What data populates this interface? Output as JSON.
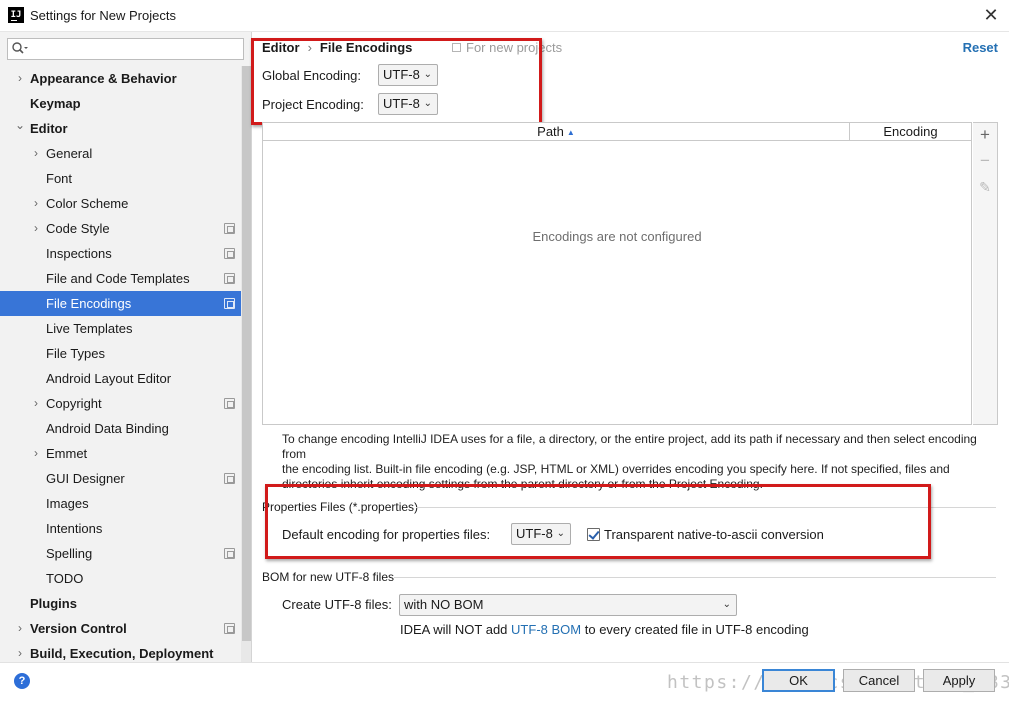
{
  "window": {
    "title": "Settings for New Projects",
    "logo_text": "IJ",
    "close_glyph": "✕"
  },
  "search": {
    "placeholder": "",
    "icon": "search-icon"
  },
  "sidebar": {
    "items": [
      {
        "label": "Appearance & Behavior",
        "level": 0,
        "arrow": "›",
        "bold": true,
        "proj": false,
        "selected": false
      },
      {
        "label": "Keymap",
        "level": 0,
        "arrow": "",
        "bold": true,
        "proj": false,
        "selected": false
      },
      {
        "label": "Editor",
        "level": 0,
        "arrow": "⌄",
        "bold": true,
        "proj": false,
        "selected": false
      },
      {
        "label": "General",
        "level": 1,
        "arrow": "›",
        "bold": false,
        "proj": false,
        "selected": false
      },
      {
        "label": "Font",
        "level": 1,
        "arrow": "",
        "bold": false,
        "proj": false,
        "selected": false
      },
      {
        "label": "Color Scheme",
        "level": 1,
        "arrow": "›",
        "bold": false,
        "proj": false,
        "selected": false
      },
      {
        "label": "Code Style",
        "level": 1,
        "arrow": "›",
        "bold": false,
        "proj": true,
        "selected": false
      },
      {
        "label": "Inspections",
        "level": 1,
        "arrow": "",
        "bold": false,
        "proj": true,
        "selected": false
      },
      {
        "label": "File and Code Templates",
        "level": 1,
        "arrow": "",
        "bold": false,
        "proj": true,
        "selected": false
      },
      {
        "label": "File Encodings",
        "level": 1,
        "arrow": "",
        "bold": false,
        "proj": true,
        "selected": true
      },
      {
        "label": "Live Templates",
        "level": 1,
        "arrow": "",
        "bold": false,
        "proj": false,
        "selected": false
      },
      {
        "label": "File Types",
        "level": 1,
        "arrow": "",
        "bold": false,
        "proj": false,
        "selected": false
      },
      {
        "label": "Android Layout Editor",
        "level": 1,
        "arrow": "",
        "bold": false,
        "proj": false,
        "selected": false
      },
      {
        "label": "Copyright",
        "level": 1,
        "arrow": "›",
        "bold": false,
        "proj": true,
        "selected": false
      },
      {
        "label": "Android Data Binding",
        "level": 1,
        "arrow": "",
        "bold": false,
        "proj": false,
        "selected": false
      },
      {
        "label": "Emmet",
        "level": 1,
        "arrow": "›",
        "bold": false,
        "proj": false,
        "selected": false
      },
      {
        "label": "GUI Designer",
        "level": 1,
        "arrow": "",
        "bold": false,
        "proj": true,
        "selected": false
      },
      {
        "label": "Images",
        "level": 1,
        "arrow": "",
        "bold": false,
        "proj": false,
        "selected": false
      },
      {
        "label": "Intentions",
        "level": 1,
        "arrow": "",
        "bold": false,
        "proj": false,
        "selected": false
      },
      {
        "label": "Spelling",
        "level": 1,
        "arrow": "",
        "bold": false,
        "proj": true,
        "selected": false
      },
      {
        "label": "TODO",
        "level": 1,
        "arrow": "",
        "bold": false,
        "proj": false,
        "selected": false
      },
      {
        "label": "Plugins",
        "level": 0,
        "arrow": "",
        "bold": true,
        "proj": false,
        "selected": false
      },
      {
        "label": "Version Control",
        "level": 0,
        "arrow": "›",
        "bold": true,
        "proj": true,
        "selected": false
      },
      {
        "label": "Build, Execution, Deployment",
        "level": 0,
        "arrow": "›",
        "bold": true,
        "proj": false,
        "selected": false
      }
    ]
  },
  "header": {
    "crumb1": "Editor",
    "crumb_sep": "›",
    "crumb2": "File Encodings",
    "for_new_projects": "For new projects",
    "reset": "Reset"
  },
  "global_encoding": {
    "label": "Global Encoding:",
    "value": "UTF-8"
  },
  "project_encoding": {
    "label": "Project Encoding:",
    "value": "UTF-8"
  },
  "table": {
    "col_path": "Path",
    "col_encoding": "Encoding",
    "sort_glyph": "▲",
    "empty": "Encodings are not configured",
    "add_glyph": "+",
    "remove_glyph": "−",
    "edit_glyph": "✎"
  },
  "help": {
    "line1": "To change encoding IntelliJ IDEA uses for a file, a directory, or the entire project, add its path if necessary and then select encoding from",
    "line2": "the encoding list. Built-in file encoding (e.g. JSP, HTML or XML) overrides encoding you specify here. If not specified, files and",
    "line3": "directories inherit encoding settings from the parent directory or from the Project Encoding."
  },
  "properties": {
    "title": "Properties Files (*.properties)",
    "default_label": "Default encoding for properties files:",
    "default_value": "UTF-8",
    "transparent_label": "Transparent native-to-ascii conversion",
    "transparent_checked": true
  },
  "bom": {
    "title": "BOM for new UTF-8 files",
    "create_label": "Create UTF-8 files:",
    "create_value": "with NO BOM",
    "note_prefix": "IDEA will NOT add",
    "note_link": "UTF-8 BOM",
    "note_suffix": "to every created file in UTF-8 encoding"
  },
  "footer": {
    "help_glyph": "?",
    "ok": "OK",
    "cancel": "Cancel",
    "apply": "Apply",
    "watermark": "https://blog.csdn.net/qq_38321262"
  },
  "colors": {
    "selection": "#3875d7",
    "annotation_red": "#d11a1a",
    "link": "#2470b3",
    "primary_border": "#3a86d6"
  }
}
